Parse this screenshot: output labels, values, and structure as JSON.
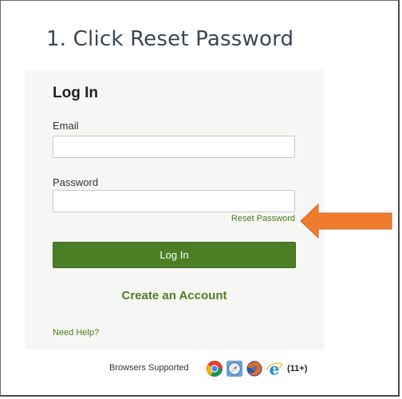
{
  "slide": {
    "step_title": "1. Click Reset Password"
  },
  "login": {
    "heading": "Log In",
    "email_label": "Email",
    "email_value": "",
    "password_label": "Password",
    "password_value": "",
    "reset_password_link": "Reset Password",
    "login_button": "Log In",
    "create_account_link": "Create an Account",
    "need_help_link": "Need Help?"
  },
  "footer": {
    "browsers_label": "Browsers Supported",
    "browser_icons": [
      "chrome-icon",
      "safari-icon",
      "firefox-icon",
      "internet-explorer-icon"
    ],
    "ie_version": "(11+)"
  },
  "colors": {
    "accent_green": "#4c7f25",
    "link_green": "#4a7a1e",
    "arrow_orange": "#ef7b2e",
    "panel_background": "#f6f6f4",
    "title_text": "#3a4655"
  }
}
